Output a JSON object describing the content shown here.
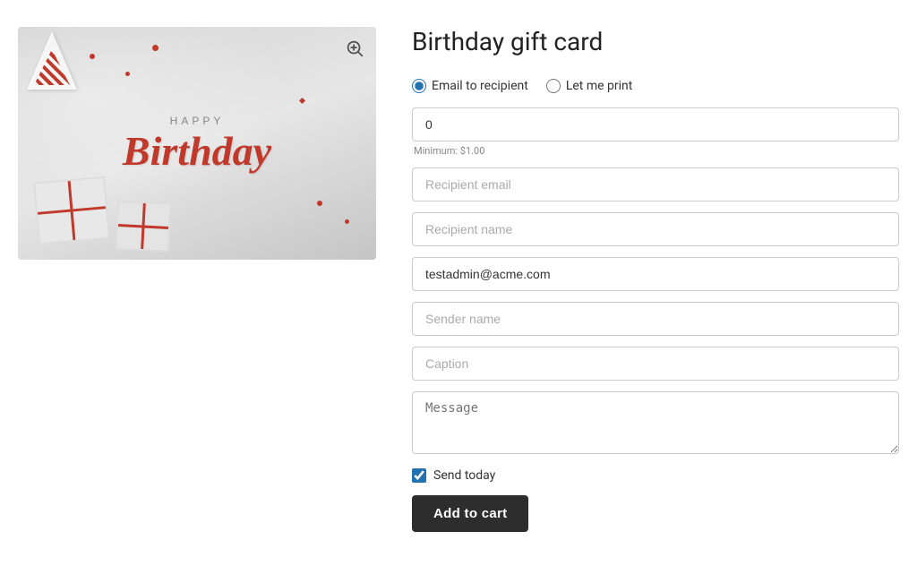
{
  "page": {
    "title": "Birthday gift card"
  },
  "delivery": {
    "option1_label": "Email to recipient",
    "option2_label": "Let me print",
    "option1_selected": true
  },
  "form": {
    "amount_value": "0",
    "minimum_label": "Minimum: $1.00",
    "recipient_email_placeholder": "Recipient email",
    "recipient_name_placeholder": "Recipient name",
    "sender_email_value": "testadmin@acme.com",
    "sender_name_placeholder": "Sender name",
    "caption_placeholder": "Caption",
    "message_placeholder": "Message"
  },
  "actions": {
    "send_today_label": "Send today",
    "send_today_checked": true,
    "add_to_cart_label": "Add to cart"
  },
  "card": {
    "happy_text": "HAPPY",
    "birthday_text": "Birthday"
  },
  "icons": {
    "zoom": "zoom-icon"
  }
}
